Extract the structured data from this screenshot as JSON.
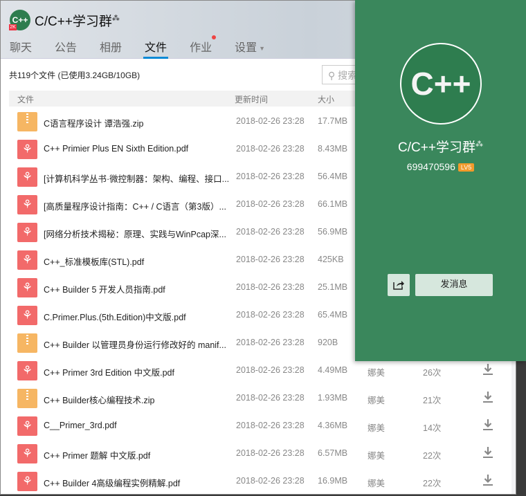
{
  "header": {
    "title": "C/C++学习群",
    "title_suffix": "⁂",
    "logo_text": "C++",
    "logo_badge": "2K",
    "tabs": [
      {
        "label": "聊天"
      },
      {
        "label": "公告"
      },
      {
        "label": "相册"
      },
      {
        "label": "文件",
        "active": true
      },
      {
        "label": "作业",
        "badge": true
      },
      {
        "label": "设置",
        "dropdown": true
      }
    ]
  },
  "summary": "共119个文件 (已使用3.24GB/10GB)",
  "search": {
    "placeholder": "搜索"
  },
  "columns": {
    "name": "文件",
    "date": "更新时间",
    "size": "大小"
  },
  "files": [
    {
      "type": "zip",
      "name": "C语言程序设计 谭浩强.zip",
      "date": "2018-02-26 23:28",
      "size": "17.7MB"
    },
    {
      "type": "pdf",
      "name": "C++ Primier Plus EN Sixth Edition.pdf",
      "date": "2018-02-26 23:28",
      "size": "8.43MB"
    },
    {
      "type": "pdf",
      "name": "[计算机科学丛书·微控制器：架构、编程、接口...",
      "date": "2018-02-26 23:28",
      "size": "56.4MB"
    },
    {
      "type": "pdf",
      "name": "[高质量程序设计指南：C++ / C语言（第3版）...",
      "date": "2018-02-26 23:28",
      "size": "66.1MB"
    },
    {
      "type": "pdf",
      "name": "[网络分析技术揭秘：原理、实践与WinPcap深...",
      "date": "2018-02-26 23:28",
      "size": "56.9MB"
    },
    {
      "type": "pdf",
      "name": "C++_标准模板库(STL).pdf",
      "date": "2018-02-26 23:28",
      "size": "425KB"
    },
    {
      "type": "pdf",
      "name": "C++ Builder 5 开发人员指南.pdf",
      "date": "2018-02-26 23:28",
      "size": "25.1MB"
    },
    {
      "type": "pdf",
      "name": "C.Primer.Plus.(5th.Edition)中文版.pdf",
      "date": "2018-02-26 23:28",
      "size": "65.4MB"
    },
    {
      "type": "zip",
      "name": "C++ Builder 以管理员身份运行修改好的 manif...",
      "date": "2018-02-26 23:28",
      "size": "920B"
    },
    {
      "type": "pdf",
      "name": "C++ Primer 3rd Edition 中文版.pdf",
      "date": "2018-02-26 23:28",
      "size": "4.49MB",
      "uploader": "娜美",
      "downloads": "26次"
    },
    {
      "type": "zip",
      "name": "C++ Builder核心编程技术.zip",
      "date": "2018-02-26 23:28",
      "size": "1.93MB",
      "uploader": "娜美",
      "downloads": "21次"
    },
    {
      "type": "pdf",
      "name": "C__Primer_3rd.pdf",
      "date": "2018-02-26 23:28",
      "size": "4.36MB",
      "uploader": "娜美",
      "downloads": "14次"
    },
    {
      "type": "pdf",
      "name": "C++ Primer 题解 中文版.pdf",
      "date": "2018-02-26 23:28",
      "size": "6.57MB",
      "uploader": "娜美",
      "downloads": "22次"
    },
    {
      "type": "pdf",
      "name": "C++ Builder 4高级编程实例精解.pdf",
      "date": "2018-02-26 23:28",
      "size": "16.9MB",
      "uploader": "娜美",
      "downloads": "22次"
    }
  ],
  "popup": {
    "avatar_text": "C++",
    "name": "C/C++学习群",
    "name_suffix": "⁂",
    "group_id": "699470596",
    "level": "LV5",
    "send_message": "发消息",
    "bg_color": "#3a875c"
  }
}
